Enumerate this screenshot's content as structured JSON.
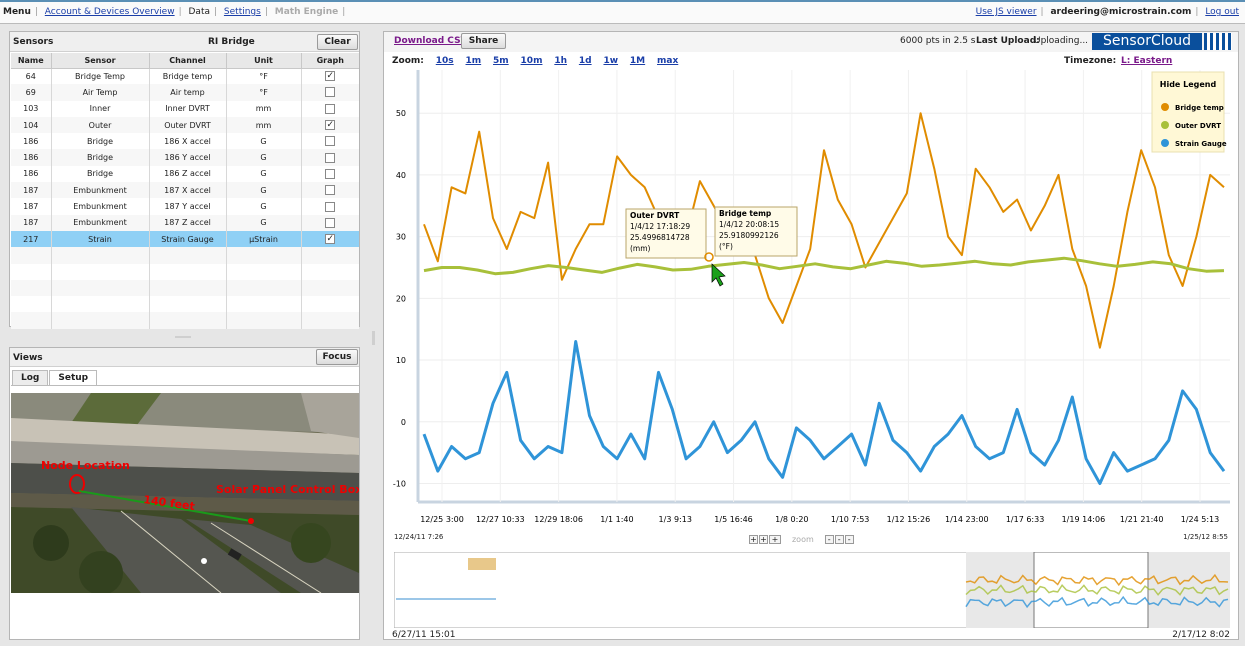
{
  "topbar": {
    "menu": "Menu",
    "links": [
      "Account & Devices Overview",
      "Data",
      "Settings",
      "Math Engine"
    ],
    "js_viewer": "Use JS viewer",
    "user": "ardeering@microstrain.com",
    "logout": "Log out"
  },
  "sensors_panel": {
    "title": "Sensors",
    "network": "RI Bridge",
    "clear_label": "Clear",
    "columns": [
      "Name",
      "Sensor",
      "Channel",
      "Unit",
      "Graph"
    ],
    "rows": [
      {
        "name": "64",
        "sensor": "Bridge Temp",
        "channel": "Bridge temp",
        "unit": "°F",
        "checked": true
      },
      {
        "name": "69",
        "sensor": "Air Temp",
        "channel": "Air temp",
        "unit": "°F",
        "checked": false
      },
      {
        "name": "103",
        "sensor": "Inner",
        "channel": "Inner DVRT",
        "unit": "mm",
        "checked": false
      },
      {
        "name": "104",
        "sensor": "Outer",
        "channel": "Outer DVRT",
        "unit": "mm",
        "checked": true
      },
      {
        "name": "186",
        "sensor": "Bridge",
        "channel": "186 X accel",
        "unit": "G",
        "checked": false
      },
      {
        "name": "186",
        "sensor": "Bridge",
        "channel": "186 Y accel",
        "unit": "G",
        "checked": false
      },
      {
        "name": "186",
        "sensor": "Bridge",
        "channel": "186 Z accel",
        "unit": "G",
        "checked": false
      },
      {
        "name": "187",
        "sensor": "Embunkment",
        "channel": "187 X accel",
        "unit": "G",
        "checked": false
      },
      {
        "name": "187",
        "sensor": "Embunkment",
        "channel": "187 Y accel",
        "unit": "G",
        "checked": false
      },
      {
        "name": "187",
        "sensor": "Embunkment",
        "channel": "187 Z accel",
        "unit": "G",
        "checked": false
      },
      {
        "name": "217",
        "sensor": "Strain",
        "channel": "Strain Gauge",
        "unit": "µStrain",
        "checked": true
      }
    ]
  },
  "views_panel": {
    "title": "Views",
    "focus_label": "Focus",
    "tabs": [
      "Log",
      "Setup"
    ],
    "map_labels": {
      "node": "Node Location",
      "distance": "140 feet",
      "solar": "Solar Panel Control Box"
    }
  },
  "chart_toolbar": {
    "download": "Download CSV",
    "share": "Share",
    "stats": "6000 pts in 2.5 s",
    "last_upload_label": "Last Upload:",
    "last_upload_value": "Uploading...",
    "brand": "SensorCloud",
    "zoom_label": "Zoom:",
    "zoom_options": [
      "10s",
      "1m",
      "5m",
      "10m",
      "1h",
      "1d",
      "1w",
      "1M",
      "max"
    ],
    "timezone_label": "Timezone:",
    "timezone_value": "L: Eastern"
  },
  "legend": {
    "hide_label": "Hide Legend",
    "items": [
      "Bridge temp",
      "Outer DVRT",
      "Strain Gauge"
    ]
  },
  "colors": {
    "bridge_temp": "#e08c00",
    "outer_dvrt": "#a8c03a",
    "strain": "#2f94d8",
    "accent": "#0a4f9c"
  },
  "tooltips": [
    {
      "title": "Outer DVRT",
      "time": "1/4/12 17:18:29",
      "value": "25.4996814728",
      "unit": "(mm)"
    },
    {
      "title": "Bridge temp",
      "time": "1/4/12 20:08:15",
      "value": "25.9180992126",
      "unit": "(°F)"
    }
  ],
  "range": {
    "main_start": "12/24/11 7:26",
    "main_end": "1/25/12 8:55",
    "overview_start": "6/27/11 15:01",
    "overview_end": "2/17/12 8:02",
    "zoom_label": "zoom"
  },
  "chart_data": {
    "type": "line",
    "x": [
      "12/25 3:00",
      "12/27 10:33",
      "12/29 18:06",
      "1/1 1:40",
      "1/3 9:13",
      "1/5 16:46",
      "1/8 0:20",
      "1/10 7:53",
      "1/12 15:26",
      "1/14 23:00",
      "1/17 6:33",
      "1/19 14:06",
      "1/21 21:40",
      "1/24 5:13"
    ],
    "yticks": [
      -10,
      0,
      10,
      20,
      30,
      40,
      50
    ],
    "ylim": [
      -13,
      57
    ],
    "series": [
      {
        "name": "Bridge temp",
        "values": [
          32,
          26,
          38,
          37,
          47,
          33,
          28,
          34,
          33,
          42,
          23,
          28,
          32,
          32,
          43,
          40,
          38,
          33,
          31,
          30,
          39,
          35,
          31,
          30,
          27,
          20,
          16,
          22,
          28,
          44,
          36,
          32,
          25,
          29,
          33,
          37,
          50,
          41,
          30,
          27,
          41,
          38,
          34,
          36,
          31,
          35,
          40,
          28,
          22,
          12,
          22,
          34,
          44,
          38,
          27,
          22,
          30,
          40,
          38
        ]
      },
      {
        "name": "Outer DVRT",
        "values": [
          24.5,
          25,
          25,
          24.6,
          24,
          24.2,
          24.8,
          25.3,
          25,
          24.6,
          24.2,
          24.9,
          25.5,
          25.1,
          24.6,
          24.7,
          25.2,
          25.5,
          25.8,
          25.4,
          24.8,
          25.2,
          25.6,
          25.1,
          24.8,
          25.4,
          26,
          25.7,
          25.2,
          25.4,
          25.7,
          26,
          25.6,
          25.4,
          25.9,
          26.2,
          26.5,
          26.1,
          25.6,
          25.2,
          25.5,
          25.9,
          25.6,
          24.8,
          24.4,
          24.5
        ]
      },
      {
        "name": "Strain Gauge",
        "values": [
          -2,
          -8,
          -4,
          -6,
          -5,
          3,
          8,
          -3,
          -6,
          -4,
          -5,
          13,
          1,
          -4,
          -6,
          -2,
          -6,
          8,
          2,
          -6,
          -4,
          0,
          -5,
          -3,
          0,
          -6,
          -9,
          -1,
          -3,
          -6,
          -4,
          -2,
          -7,
          3,
          -3,
          -5,
          -8,
          -4,
          -2,
          1,
          -4,
          -6,
          -5,
          2,
          -5,
          -7,
          -3,
          4,
          -6,
          -10,
          -5,
          -8,
          -7,
          -6,
          -3,
          5,
          2,
          -5,
          -8
        ]
      }
    ]
  }
}
